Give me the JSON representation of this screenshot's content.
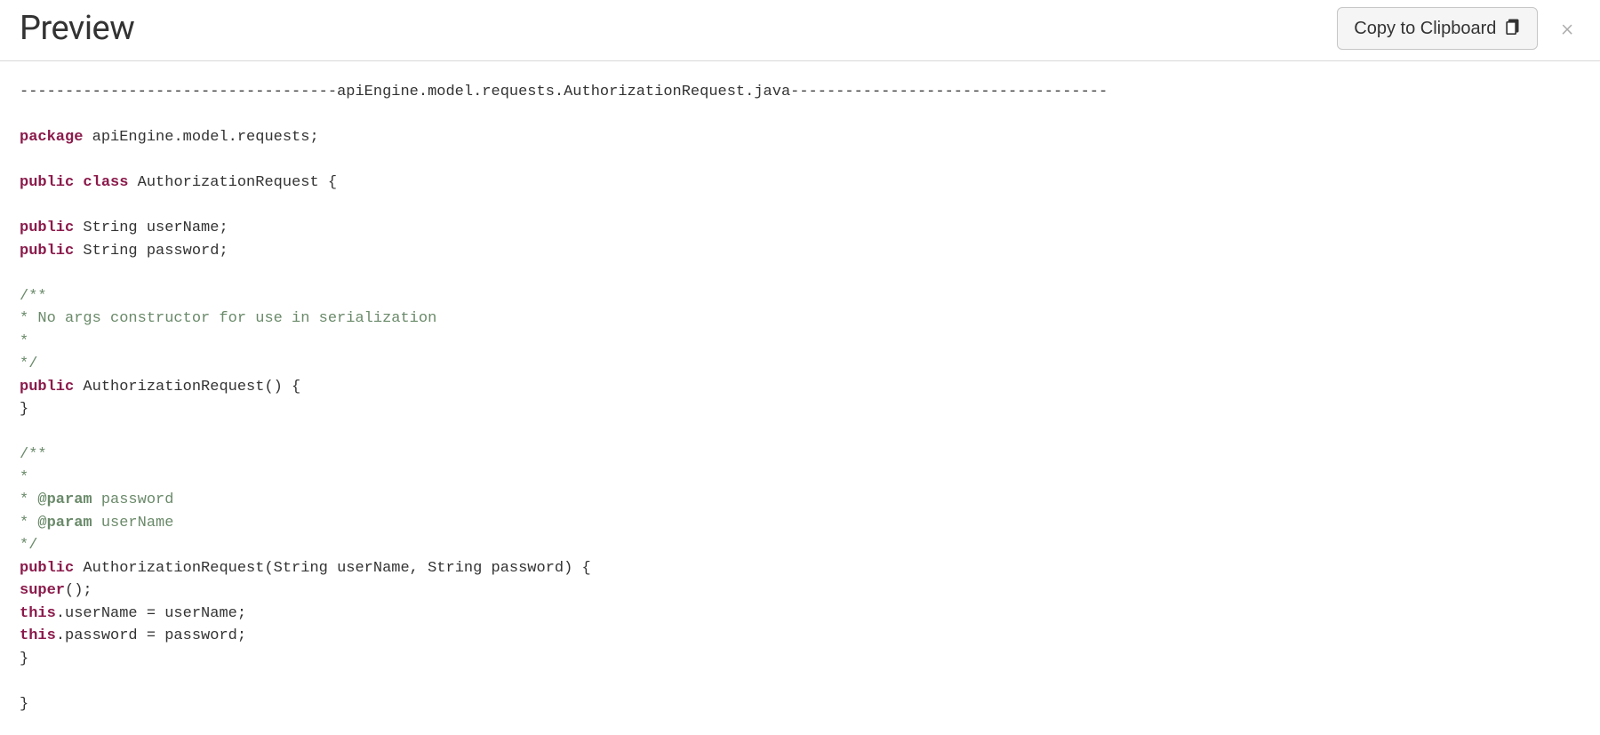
{
  "header": {
    "title": "Preview",
    "copy_label": "Copy to Clipboard",
    "close_label": "×"
  },
  "code": {
    "divider_prefix": "-----------------------------------",
    "filename": "apiEngine.model.requests.AuthorizationRequest.java",
    "divider_suffix": "-----------------------------------",
    "kw_package": "package",
    "package_name": " apiEngine.model.requests;",
    "kw_public1": "public",
    "kw_class": "class",
    "class_decl": " AuthorizationRequest {",
    "kw_public2": "public",
    "field1": " String userName;",
    "kw_public3": "public",
    "field2": " String password;",
    "comment1_l1": "/**",
    "comment1_l2": "* No args constructor for use in serialization",
    "comment1_l3": "*",
    "comment1_l4": "*/",
    "kw_public4": "public",
    "ctor1": " AuthorizationRequest() {",
    "ctor1_close": "}",
    "comment2_l1": "/**",
    "comment2_l2": "*",
    "comment2_l3a": "* ",
    "comment2_l3_tag": "@param",
    "comment2_l3b": " password",
    "comment2_l4a": "* ",
    "comment2_l4_tag": "@param",
    "comment2_l4b": " userName",
    "comment2_l5": "*/",
    "kw_public5": "public",
    "ctor2": " AuthorizationRequest(String userName, String password) {",
    "kw_super": "super",
    "super_tail": "();",
    "kw_this1": "this",
    "assign1": ".userName = userName;",
    "kw_this2": "this",
    "assign2": ".password = password;",
    "ctor2_close": "}",
    "class_close": "}"
  }
}
